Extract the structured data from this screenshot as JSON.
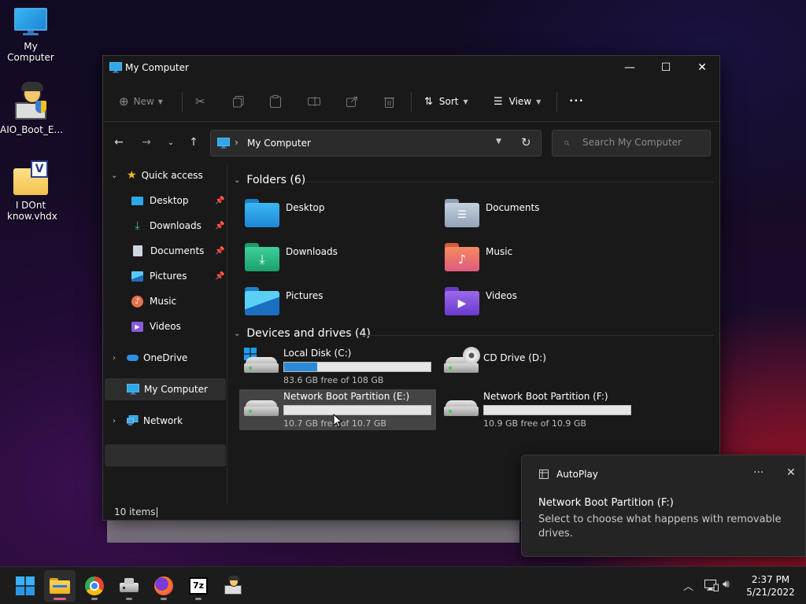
{
  "desktop": {
    "icons": [
      {
        "label": "My Computer"
      },
      {
        "label": "AIO_Boot_E..."
      },
      {
        "label": "I DOnt know.vhdx"
      }
    ]
  },
  "window": {
    "title": "My Computer",
    "controls": {
      "minimize": "—",
      "maximize": "☐",
      "close": "✕"
    },
    "toolbar": {
      "new_label": "New",
      "sort_label": "Sort",
      "view_label": "View",
      "more_label": "•••"
    },
    "address": {
      "path": "My Computer",
      "search_placeholder": "Search My Computer"
    },
    "sidebar": {
      "quick_access": "Quick access",
      "items": [
        {
          "label": "Desktop"
        },
        {
          "label": "Downloads"
        },
        {
          "label": "Documents"
        },
        {
          "label": "Pictures"
        },
        {
          "label": "Music"
        },
        {
          "label": "Videos"
        }
      ],
      "onedrive": "OneDrive",
      "my_computer": "My Computer",
      "network": "Network"
    },
    "folders": {
      "heading": "Folders (6)",
      "items": [
        {
          "name": "Desktop"
        },
        {
          "name": "Documents"
        },
        {
          "name": "Downloads"
        },
        {
          "name": "Music"
        },
        {
          "name": "Pictures"
        },
        {
          "name": "Videos"
        }
      ]
    },
    "drives": {
      "heading": "Devices and drives (4)",
      "items": [
        {
          "name": "Local Disk (C:)",
          "free": "83.6 GB free of 108 GB",
          "used_fraction": 0.226
        },
        {
          "name": "CD Drive (D:)"
        },
        {
          "name": "Network Boot Partition (E:)",
          "free": "10.7 GB free of 10.7 GB",
          "used_fraction": 0.0
        },
        {
          "name": "Network Boot Partition (F:)",
          "free": "10.9 GB free of 10.9 GB",
          "used_fraction": 0.0
        }
      ]
    },
    "status": {
      "count": "10 items"
    }
  },
  "toast": {
    "app": "AutoPlay",
    "heading": "Network Boot Partition (F:)",
    "message": "Select to choose what happens with removable drives."
  },
  "taskbar": {
    "time": "2:37 PM",
    "date": "5/21/2022",
    "app_7z": "7z"
  },
  "colors": {
    "accent": "#2b8bd8",
    "window_bg": "#191919",
    "selected_bg": "#444444"
  }
}
